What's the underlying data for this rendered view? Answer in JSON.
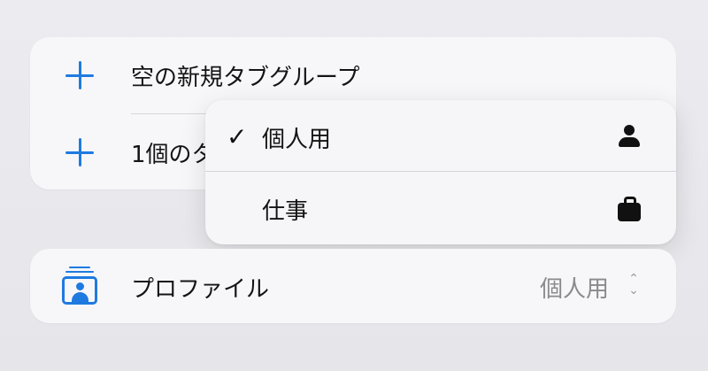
{
  "tab_group_menu": {
    "items": [
      {
        "label": "空の新規タブグループ",
        "icon": "plus-icon"
      },
      {
        "label": "1個のタ",
        "icon": "plus-icon"
      }
    ]
  },
  "profile_popup": {
    "options": [
      {
        "label": "個人用",
        "selected": true,
        "icon": "person-icon"
      },
      {
        "label": "仕事",
        "selected": false,
        "icon": "briefcase-icon"
      }
    ],
    "check_glyph": "✓"
  },
  "profile_row": {
    "label": "プロファイル",
    "value": "個人用",
    "icon": "profile-stack-icon",
    "chevron": "⌃⌄"
  },
  "colors": {
    "accent": "#1f7ae0",
    "secondary_text": "#8a8a8e"
  }
}
